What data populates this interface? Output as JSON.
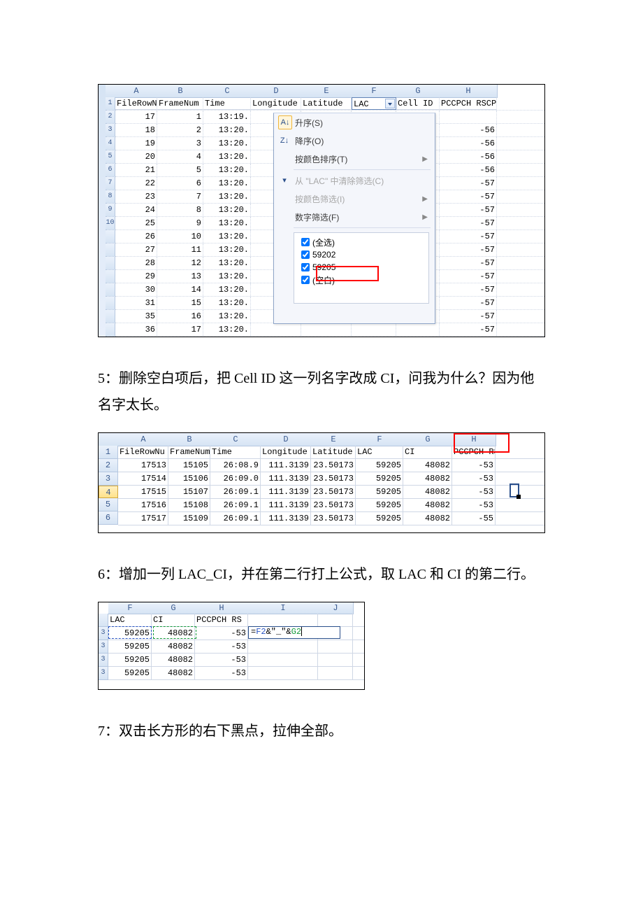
{
  "excel1": {
    "colheads": [
      "A",
      "B",
      "C",
      "D",
      "E",
      "F",
      "G",
      "H"
    ],
    "colx": [
      24,
      84,
      150,
      218,
      290,
      362,
      426,
      488,
      570
    ],
    "header_row": {
      "A": "FileRowNu",
      "B": "FrameNum",
      "C": "Time",
      "D": "Longitude",
      "E": "Latitude",
      "F": "LAC",
      "G": "Cell ID",
      "H": "PCCPCH RSCP"
    },
    "rows": [
      {
        "A": "17",
        "B": "1",
        "C": "13:19.",
        "H": ""
      },
      {
        "A": "18",
        "B": "2",
        "C": "13:20.",
        "H": "-56"
      },
      {
        "A": "19",
        "B": "3",
        "C": "13:20.",
        "H": "-56"
      },
      {
        "A": "20",
        "B": "4",
        "C": "13:20.",
        "H": "-56"
      },
      {
        "A": "21",
        "B": "5",
        "C": "13:20.",
        "H": "-56"
      },
      {
        "A": "22",
        "B": "6",
        "C": "13:20.",
        "H": "-57"
      },
      {
        "A": "23",
        "B": "7",
        "C": "13:20.",
        "H": "-57"
      },
      {
        "A": "24",
        "B": "8",
        "C": "13:20.",
        "H": "-57"
      },
      {
        "A": "25",
        "B": "9",
        "C": "13:20.",
        "H": "-57"
      },
      {
        "A": "26",
        "B": "10",
        "C": "13:20.",
        "H": "-57"
      },
      {
        "A": "27",
        "B": "11",
        "C": "13:20.",
        "H": "-57"
      },
      {
        "A": "28",
        "B": "12",
        "C": "13:20.",
        "H": "-57"
      },
      {
        "A": "29",
        "B": "13",
        "C": "13:20.",
        "H": "-57"
      },
      {
        "A": "30",
        "B": "14",
        "C": "13:20.",
        "H": "-57"
      },
      {
        "A": "31",
        "B": "15",
        "C": "13:20.",
        "H": "-57"
      },
      {
        "A": "35",
        "B": "16",
        "C": "13:20.",
        "H": "-57"
      },
      {
        "A": "36",
        "B": "17",
        "C": "13:20.",
        "H": "-57"
      }
    ],
    "dropdown": {
      "sort_asc": "升序(S)",
      "sort_desc": "降序(O)",
      "sort_color": "按颜色排序(T)",
      "clear_filter": "从 \"LAC\" 中清除筛选(C)",
      "filter_color": "按颜色筛选(I)",
      "number_filter": "数字筛选(F)",
      "select_all": "(全选)",
      "opt1": "59202",
      "opt2": "59205",
      "opt_blank": "(空白)"
    }
  },
  "para5": "5：删除空白项后，把 Cell ID 这一列名字改成 CI，问我为什么？因为他名字太长。",
  "excel2": {
    "colheads": [
      "A",
      "B",
      "C",
      "D",
      "E",
      "F",
      "G",
      "H"
    ],
    "colx": [
      28,
      100,
      160,
      232,
      304,
      368,
      436,
      506,
      568
    ],
    "rownums": [
      "1",
      "2",
      "3",
      "4",
      "5",
      "6"
    ],
    "header_row": {
      "A": "FileRowNu",
      "B": "FrameNum",
      "C": "Time",
      "D": "Longitude",
      "E": "Latitude",
      "F": "LAC",
      "G": "CI",
      "H": "PCCPCH RSCP"
    },
    "rows": [
      {
        "A": "17513",
        "B": "15105",
        "C": "26:08.9",
        "D": "111.3139",
        "E": "23.50173",
        "F": "59205",
        "G": "48082",
        "H": "-53"
      },
      {
        "A": "17514",
        "B": "15106",
        "C": "26:09.0",
        "D": "111.3139",
        "E": "23.50173",
        "F": "59205",
        "G": "48082",
        "H": "-53"
      },
      {
        "A": "17515",
        "B": "15107",
        "C": "26:09.1",
        "D": "111.3139",
        "E": "23.50173",
        "F": "59205",
        "G": "48082",
        "H": "-53"
      },
      {
        "A": "17516",
        "B": "15108",
        "C": "26:09.1",
        "D": "111.3139",
        "E": "23.50173",
        "F": "59205",
        "G": "48082",
        "H": "-53"
      },
      {
        "A": "17517",
        "B": "15109",
        "C": "26:09.1",
        "D": "111.3139",
        "E": "23.50173",
        "F": "59205",
        "G": "48082",
        "H": "-55"
      }
    ]
  },
  "para6": "6：增加一列 LAC_CI，并在第二行打上公式，取 LAC 和 CI 的第二行。",
  "excel3": {
    "colheads": [
      "F",
      "G",
      "H",
      "I",
      "J"
    ],
    "colx": [
      14,
      76,
      138,
      214,
      314,
      364
    ],
    "header_row": {
      "F": "LAC",
      "G": "CI",
      "H": "PCCPCH RS",
      "I": "",
      "J": ""
    },
    "rownums": [
      "",
      "3",
      "3",
      "3",
      "3"
    ],
    "rows": [
      {
        "F": "59205",
        "G": "48082",
        "H": "-53",
        "I": ""
      },
      {
        "F": "59205",
        "G": "48082",
        "H": "-53",
        "I": ""
      },
      {
        "F": "59205",
        "G": "48082",
        "H": "-53",
        "I": ""
      },
      {
        "F": "59205",
        "G": "48082",
        "H": "-53",
        "I": ""
      }
    ],
    "formula_eq": "=",
    "formula_f": "F2",
    "formula_mid": "&\"_\"&",
    "formula_g": "G2"
  },
  "para7": "7：双击长方形的右下黑点，拉伸全部。"
}
